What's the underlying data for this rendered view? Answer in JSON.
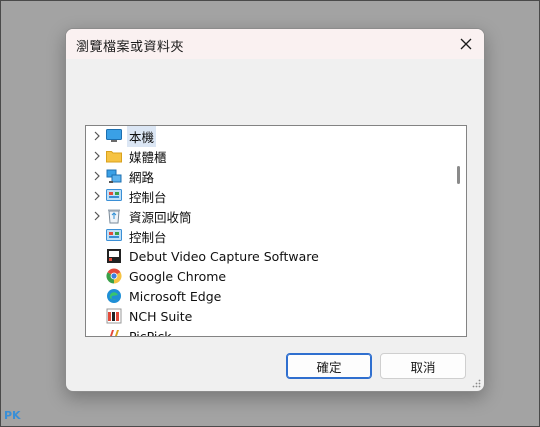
{
  "dialog": {
    "title": "瀏覽檔案或資料夾",
    "close_icon": "close-icon"
  },
  "tree": {
    "items": [
      {
        "label": "本機",
        "icon": "monitor-icon",
        "expandable": true,
        "selected": true
      },
      {
        "label": "媒體櫃",
        "icon": "folder-icon",
        "expandable": true,
        "selected": false
      },
      {
        "label": "網路",
        "icon": "network-icon",
        "expandable": true,
        "selected": false
      },
      {
        "label": "控制台",
        "icon": "control-panel-icon",
        "expandable": true,
        "selected": false
      },
      {
        "label": "資源回收筒",
        "icon": "recycle-bin-icon",
        "expandable": true,
        "selected": false
      },
      {
        "label": "控制台",
        "icon": "control-panel-icon",
        "expandable": false,
        "selected": false
      },
      {
        "label": "Debut Video Capture Software",
        "icon": "debut-app-icon",
        "expandable": false,
        "selected": false
      },
      {
        "label": "Google Chrome",
        "icon": "chrome-icon",
        "expandable": false,
        "selected": false
      },
      {
        "label": "Microsoft Edge",
        "icon": "edge-icon",
        "expandable": false,
        "selected": false
      },
      {
        "label": "NCH Suite",
        "icon": "nch-icon",
        "expandable": false,
        "selected": false
      },
      {
        "label": "PicPick",
        "icon": "picpick-icon",
        "expandable": false,
        "selected": false
      }
    ]
  },
  "buttons": {
    "ok": "確定",
    "cancel": "取消"
  },
  "watermark": "PK",
  "colors": {
    "accent": "#2f6fcf",
    "selection": "#dbe6f4",
    "title_bar": "#faf1f1"
  }
}
